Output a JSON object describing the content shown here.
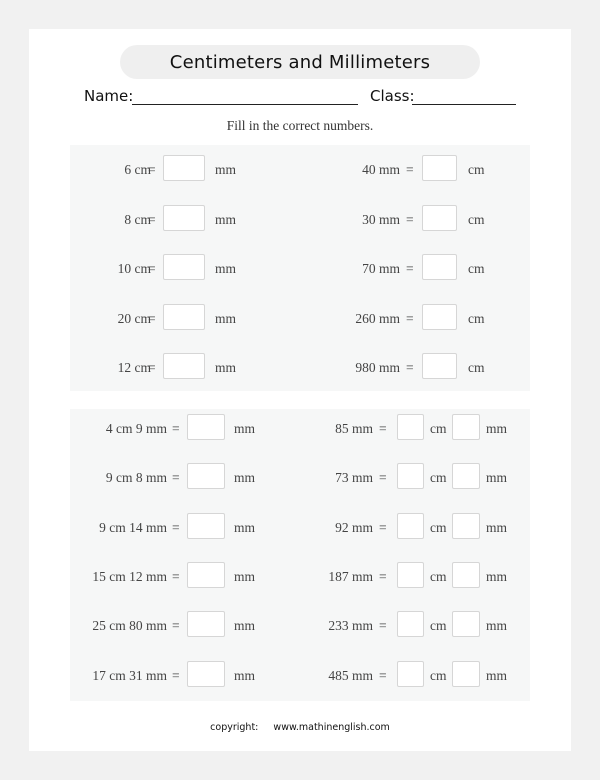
{
  "title": "Centimeters and Millimeters",
  "header": {
    "name_label": "Name:",
    "class_label": "Class:"
  },
  "instruction": "Fill in the correct numbers.",
  "section1": {
    "left": [
      {
        "given": "6 cm",
        "eq": "=",
        "unit": "mm"
      },
      {
        "given": "8 cm",
        "eq": "=",
        "unit": "mm"
      },
      {
        "given": "10 cm",
        "eq": "=",
        "unit": "mm"
      },
      {
        "given": "20 cm",
        "eq": "=",
        "unit": "mm"
      },
      {
        "given": "12 cm",
        "eq": "=",
        "unit": "mm"
      }
    ],
    "right": [
      {
        "given": "40 mm",
        "eq": "=",
        "unit": "cm"
      },
      {
        "given": "30 mm",
        "eq": "=",
        "unit": "cm"
      },
      {
        "given": "70 mm",
        "eq": "=",
        "unit": "cm"
      },
      {
        "given": "260 mm",
        "eq": "=",
        "unit": "cm"
      },
      {
        "given": "980 mm",
        "eq": "=",
        "unit": "cm"
      }
    ]
  },
  "section2": {
    "left": [
      {
        "given": "4 cm 9 mm",
        "eq": "=",
        "unit": "mm"
      },
      {
        "given": "9 cm 8 mm",
        "eq": "=",
        "unit": "mm"
      },
      {
        "given": "9 cm 14 mm",
        "eq": "=",
        "unit": "mm"
      },
      {
        "given": "15 cm 12 mm",
        "eq": "=",
        "unit": "mm"
      },
      {
        "given": "25 cm 80 mm",
        "eq": "=",
        "unit": "mm"
      },
      {
        "given": "17 cm 31 mm",
        "eq": "=",
        "unit": "mm"
      }
    ],
    "right": [
      {
        "given": "85 mm",
        "eq": "=",
        "unit1": "cm",
        "unit2": "mm"
      },
      {
        "given": "73 mm",
        "eq": "=",
        "unit1": "cm",
        "unit2": "mm"
      },
      {
        "given": "92 mm",
        "eq": "=",
        "unit1": "cm",
        "unit2": "mm"
      },
      {
        "given": "187 mm",
        "eq": "=",
        "unit1": "cm",
        "unit2": "mm"
      },
      {
        "given": "233 mm",
        "eq": "=",
        "unit1": "cm",
        "unit2": "mm"
      },
      {
        "given": "485 mm",
        "eq": "=",
        "unit1": "cm",
        "unit2": "mm"
      }
    ]
  },
  "footer": {
    "copyright_label": "copyright:",
    "website": "www.mathinenglish.com"
  }
}
